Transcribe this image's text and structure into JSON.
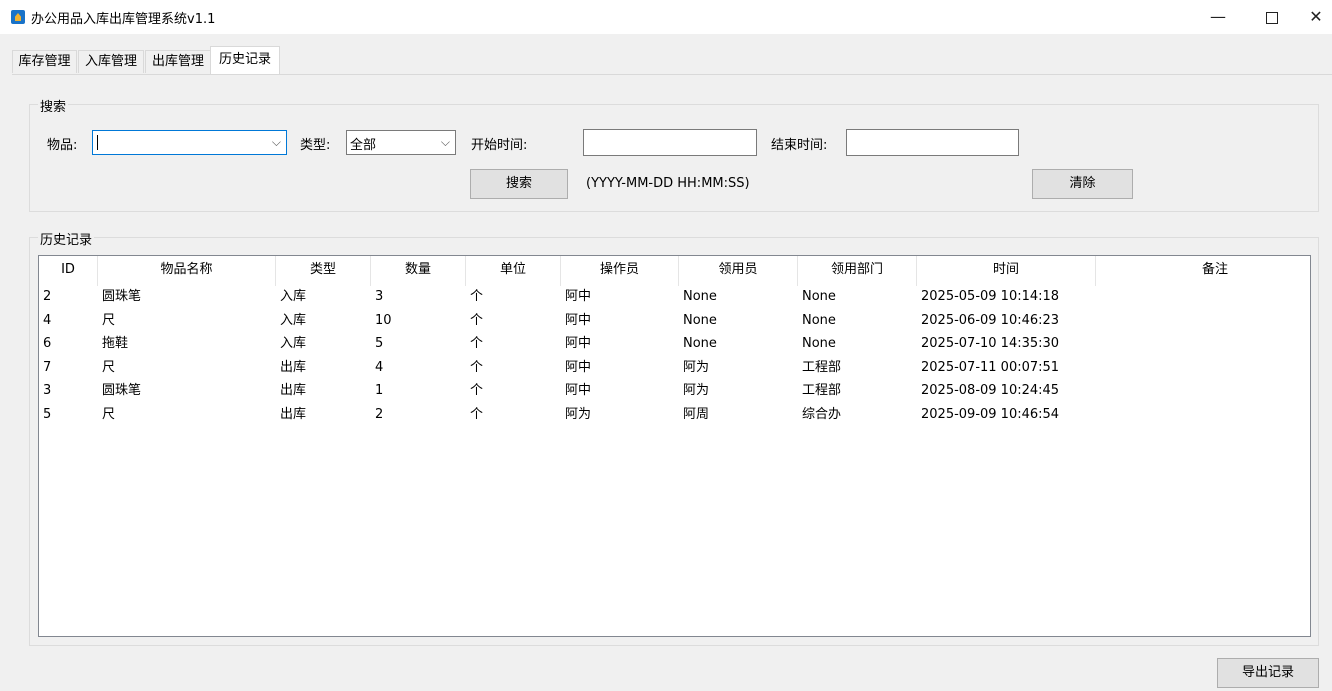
{
  "window": {
    "title": "办公用品入库出库管理系统v1.1",
    "minimize": "—",
    "close": "✕"
  },
  "tabs": [
    "库存管理",
    "入库管理",
    "出库管理",
    "历史记录"
  ],
  "active_tab": "历史记录",
  "search": {
    "group_title": "搜索",
    "item_label": "物品:",
    "item_value": "",
    "type_label": "类型:",
    "type_value": "全部",
    "start_label": "开始时间:",
    "start_value": "",
    "end_label": "结束时间:",
    "end_value": "",
    "search_button": "搜索",
    "format_hint": "(YYYY-MM-DD HH:MM:SS)",
    "clear_button": "清除"
  },
  "history": {
    "group_title": "历史记录",
    "columns": [
      "ID",
      "物品名称",
      "类型",
      "数量",
      "单位",
      "操作员",
      "领用员",
      "领用部门",
      "时间",
      "备注"
    ],
    "rows": [
      [
        "2",
        "圆珠笔",
        "入库",
        "3",
        "个",
        "阿中",
        "None",
        "None",
        "2025-05-09 10:14:18",
        ""
      ],
      [
        "4",
        "尺",
        "入库",
        "10",
        "个",
        "阿中",
        "None",
        "None",
        "2025-06-09 10:46:23",
        ""
      ],
      [
        "6",
        "拖鞋",
        "入库",
        "5",
        "个",
        "阿中",
        "None",
        "None",
        "2025-07-10 14:35:30",
        ""
      ],
      [
        "7",
        "尺",
        "出库",
        "4",
        "个",
        "阿中",
        "阿为",
        "工程部",
        "2025-07-11 00:07:51",
        ""
      ],
      [
        "3",
        "圆珠笔",
        "出库",
        "1",
        "个",
        "阿中",
        "阿为",
        "工程部",
        "2025-08-09 10:24:45",
        ""
      ],
      [
        "5",
        "尺",
        "出库",
        "2",
        "个",
        "阿为",
        "阿周",
        "综合办",
        "2025-09-09 10:46:54",
        ""
      ]
    ]
  },
  "export_button": "导出记录",
  "icons": {
    "app": "app-house-icon",
    "minimize": "minimize-icon",
    "maximize": "maximize-icon",
    "close": "close-icon",
    "dropdown": "chevron-down-icon"
  }
}
